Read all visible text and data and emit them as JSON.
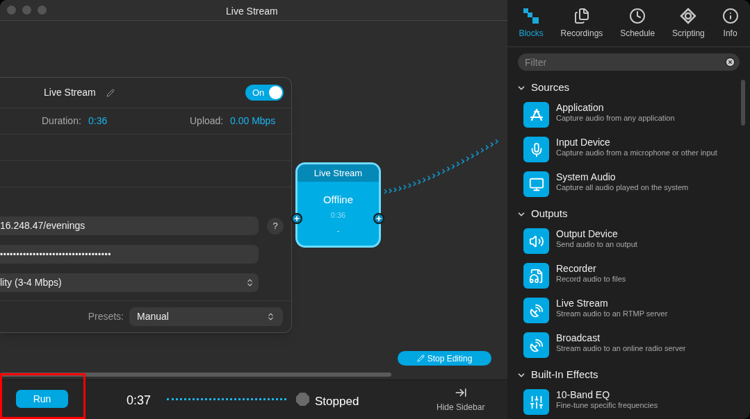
{
  "window": {
    "title": "Live Stream"
  },
  "stream_panel": {
    "title": "Live Stream",
    "toggle": {
      "label": "On",
      "on": true
    },
    "duration_label": "Duration:",
    "duration": "0:36",
    "upload_label": "Upload:",
    "upload": "0.00 Mbps",
    "server_url": "16.248.47/evenings",
    "help": "?",
    "stream_key": "••••••••••••••••••••••••••••••••••",
    "quality": "lity (3-4 Mbps)",
    "presets_label": "Presets:",
    "preset": "Manual"
  },
  "node": {
    "title": "Live Stream",
    "status": "Offline",
    "time": "0:36",
    "detail": "-"
  },
  "stop_editing": "Stop Editing",
  "sidebar": {
    "tabs": [
      {
        "label": "Blocks",
        "kind": "blocks",
        "selected": true
      },
      {
        "label": "Recordings",
        "kind": "recordings",
        "selected": false
      },
      {
        "label": "Schedule",
        "kind": "schedule",
        "selected": false
      },
      {
        "label": "Scripting",
        "kind": "scripting",
        "selected": false
      },
      {
        "label": "Info",
        "kind": "info",
        "selected": false
      }
    ],
    "filter": {
      "placeholder": "Filter"
    },
    "sections": [
      {
        "title": "Sources",
        "expanded": true,
        "items": [
          {
            "name": "Application",
            "description": "Capture audio from any application",
            "kind": "application"
          },
          {
            "name": "Input Device",
            "description": "Capture audio from a microphone or other input",
            "kind": "microphone"
          },
          {
            "name": "System Audio",
            "description": "Capture all audio played on the system",
            "kind": "monitor"
          }
        ]
      },
      {
        "title": "Outputs",
        "expanded": true,
        "items": [
          {
            "name": "Output Device",
            "description": "Send audio to an output",
            "kind": "speaker"
          },
          {
            "name": "Recorder",
            "description": "Record audio to files",
            "kind": "file"
          },
          {
            "name": "Live Stream",
            "description": "Stream audio to an RTMP server",
            "kind": "dish"
          },
          {
            "name": "Broadcast",
            "description": "Stream audio to an online radio server",
            "kind": "dish"
          }
        ]
      },
      {
        "title": "Built-In Effects",
        "expanded": true,
        "items": [
          {
            "name": "10-Band EQ",
            "description": "Fine-tune specific frequencies",
            "kind": "sliders"
          }
        ]
      }
    ]
  },
  "toolbar": {
    "run": "Run",
    "time": "0:37",
    "status": "Stopped",
    "hide_sidebar": "Hide Sidebar"
  }
}
